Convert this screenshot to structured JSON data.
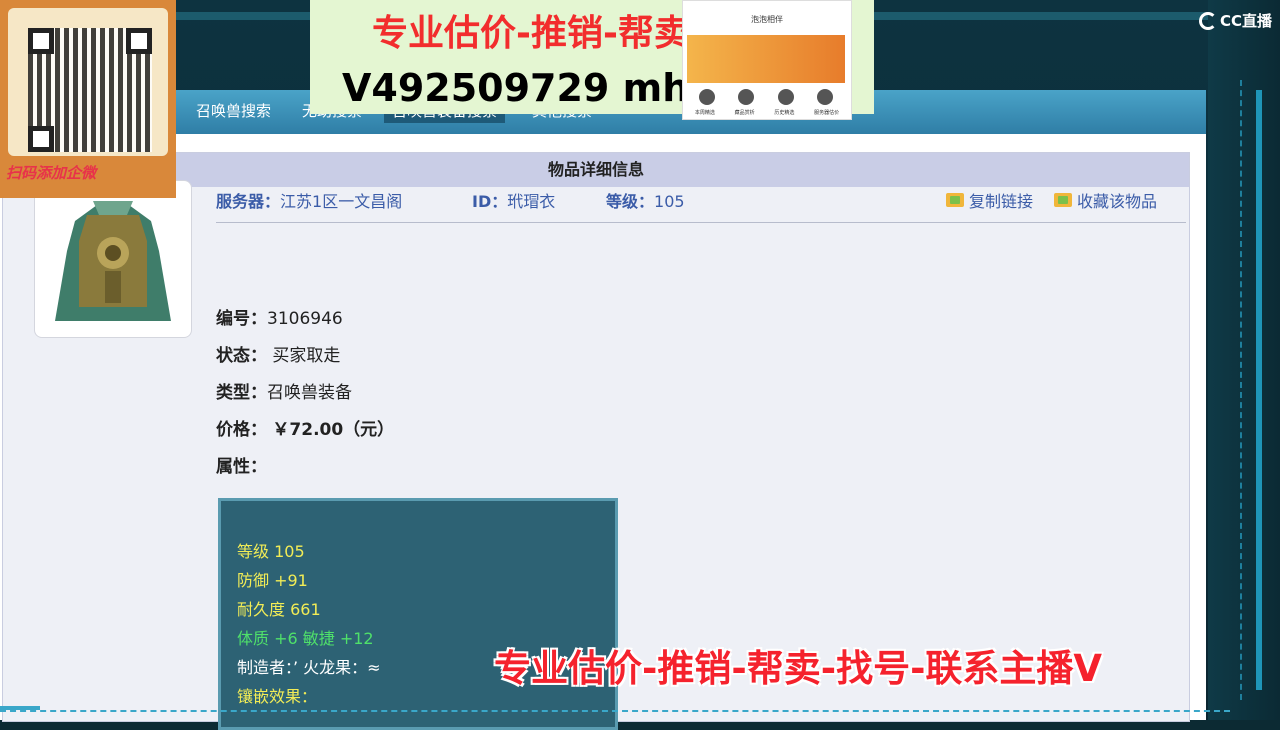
{
  "stream": {
    "brand": "CC直播",
    "bottom_banner": "专业估价-推销-帮卖-找号-联系主播V"
  },
  "promo": {
    "line1": "专业估价-推销-帮卖",
    "line2": "V492509729   mhx",
    "phone_title": "泡泡相伴",
    "phone_labels": [
      "本周精选",
      "藏品赏析",
      "历史精选",
      "服务器估价"
    ]
  },
  "qr": {
    "caption": "扫码添加企微"
  },
  "nav": {
    "items": [
      "召唤兽搜索",
      "无助搜索",
      "召唤兽装备搜索",
      "其他搜索"
    ]
  },
  "detail": {
    "panel_title": "物品详细信息",
    "server_label": "服务器：",
    "server_value": "江苏1区一文昌阁",
    "id_label": "ID：",
    "id_value": "玳瑁衣",
    "level_label": "等级：",
    "level_value": "105",
    "copy_link": "复制链接",
    "favorite": "收藏该物品",
    "serial_label": "编号：",
    "serial_value": "3106946",
    "status_label": "状态：",
    "status_value": "买家取走",
    "type_label": "类型：",
    "type_value": "召唤兽装备",
    "price_label": "价格：",
    "price_value": "￥72.00（元）",
    "attr_label": "属性："
  },
  "attributes": {
    "level": "等级 105",
    "defense": "防御 +91",
    "durability": "耐久度 661",
    "stats": "体质 +6 敏捷 +12",
    "maker": "制造者：’ 火龙果：≈",
    "inlay": "镶嵌效果："
  }
}
